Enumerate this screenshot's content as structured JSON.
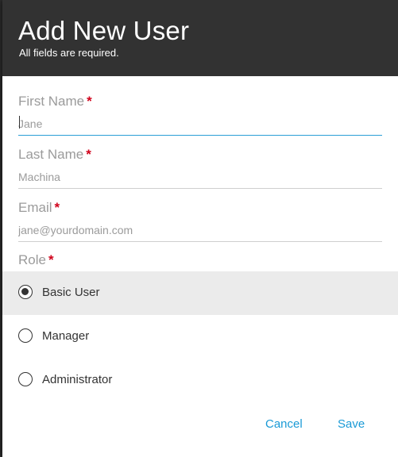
{
  "header": {
    "title": "Add New User",
    "subtitle": "All fields are required."
  },
  "fields": {
    "first_name": {
      "label": "First Name",
      "required_mark": "*",
      "placeholder": "Jane",
      "value": ""
    },
    "last_name": {
      "label": "Last Name",
      "required_mark": "*",
      "placeholder": "Machina",
      "value": ""
    },
    "email": {
      "label": "Email",
      "required_mark": "*",
      "placeholder": "jane@yourdomain.com",
      "value": ""
    }
  },
  "role": {
    "label": "Role",
    "required_mark": "*",
    "selected": "Basic User",
    "options": [
      {
        "label": "Basic User"
      },
      {
        "label": "Manager"
      },
      {
        "label": "Administrator"
      }
    ]
  },
  "actions": {
    "cancel_label": "Cancel",
    "save_label": "Save"
  },
  "colors": {
    "header_bg": "#323232",
    "accent": "#1a9ad6",
    "required": "#d0021b",
    "selected_row": "#ebebeb",
    "focus_underline": "#2a9fd6"
  }
}
